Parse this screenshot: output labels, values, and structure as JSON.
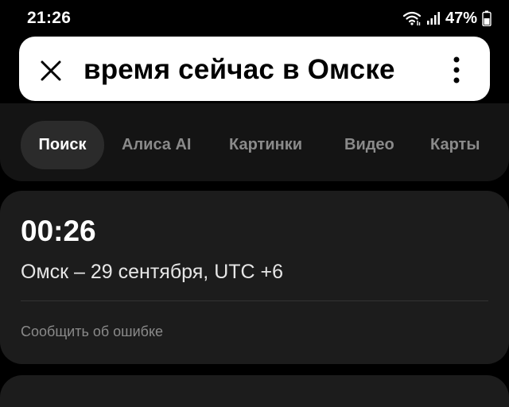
{
  "status_bar": {
    "time": "21:26",
    "battery": "47%",
    "icons": [
      "wifi-icon",
      "signal-icon",
      "battery-icon"
    ]
  },
  "search": {
    "query": "время сейчас в Омске",
    "close_icon": "close-icon",
    "more_icon": "more-vertical-icon"
  },
  "tabs": [
    {
      "label": "Поиск",
      "active": true
    },
    {
      "label": "Алиса AI",
      "active": false
    },
    {
      "label": "Картинки",
      "active": false
    },
    {
      "label": "Видео",
      "active": false
    },
    {
      "label": "Карты",
      "active": false
    }
  ],
  "time_card": {
    "time": "00:26",
    "description": "Омск – 29 сентября, UTC +6",
    "report_link": "Сообщить об ошибке"
  },
  "colors": {
    "background": "#000000",
    "panel": "#141414",
    "card": "#1c1c1c",
    "active_tab": "#2b2b2b",
    "muted_text": "#8a8a8a"
  }
}
